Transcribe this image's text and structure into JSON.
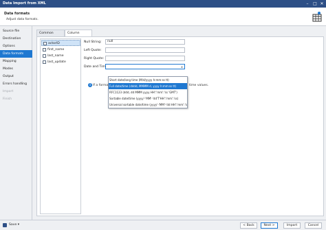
{
  "window": {
    "title": "Data Import from XML"
  },
  "header": {
    "title": "Data formats",
    "subtitle": "Adjust data formats."
  },
  "sidebar": {
    "items": [
      {
        "label": "Source file",
        "state": "normal"
      },
      {
        "label": "Destination",
        "state": "normal"
      },
      {
        "label": "Options",
        "state": "normal"
      },
      {
        "label": "Data formats",
        "state": "active"
      },
      {
        "label": "Mapping",
        "state": "normal"
      },
      {
        "label": "Modes",
        "state": "normal"
      },
      {
        "label": "Output",
        "state": "normal"
      },
      {
        "label": "Errors handling",
        "state": "normal"
      },
      {
        "label": "Import",
        "state": "disabled"
      },
      {
        "label": "Finish",
        "state": "disabled"
      }
    ]
  },
  "tabs": [
    {
      "label": "Common Formats",
      "active": false
    },
    {
      "label": "Column Settings",
      "active": true
    }
  ],
  "columns": [
    "actorID",
    "first_name",
    "last_name",
    "last_update"
  ],
  "form": {
    "null_string_label": "Null String:",
    "null_string_value": "null",
    "left_quote_label": "Left Quote:",
    "left_quote_value": "",
    "right_quote_label": "Right Quote:",
    "right_quote_value": "",
    "datetime_label": "Date and Time:",
    "datetime_value": "",
    "info_prefix": "If a format",
    "info_suffix": "time values."
  },
  "datetime_options": [
    {
      "label": "Short date/long time (M/d/yyyy h:mm:ss tt)",
      "selected": false
    },
    {
      "label": "Full date/time (dddd, MMMM d, yyyy h:mm:ss tt)",
      "selected": true
    },
    {
      "label": "RFC1123 (ddd, dd MMM yyyy HH':'mm':'ss 'GMT')",
      "selected": false
    },
    {
      "label": "Sortable date/time (yyyy'-'MM'-'dd'T'HH':'mm':'ss)",
      "selected": false
    },
    {
      "label": "Universal sortable date/time (yyyy'-'MM'-'dd HH':'mm':'ss'Z')",
      "selected": false
    }
  ],
  "footer": {
    "save_label": "Save",
    "back_label": "< Back",
    "next_label": "Next >",
    "import_label": "Import",
    "cancel_label": "Cancel"
  },
  "colors": {
    "accent": "#1f78d1",
    "titlebar": "#2d4f86"
  }
}
